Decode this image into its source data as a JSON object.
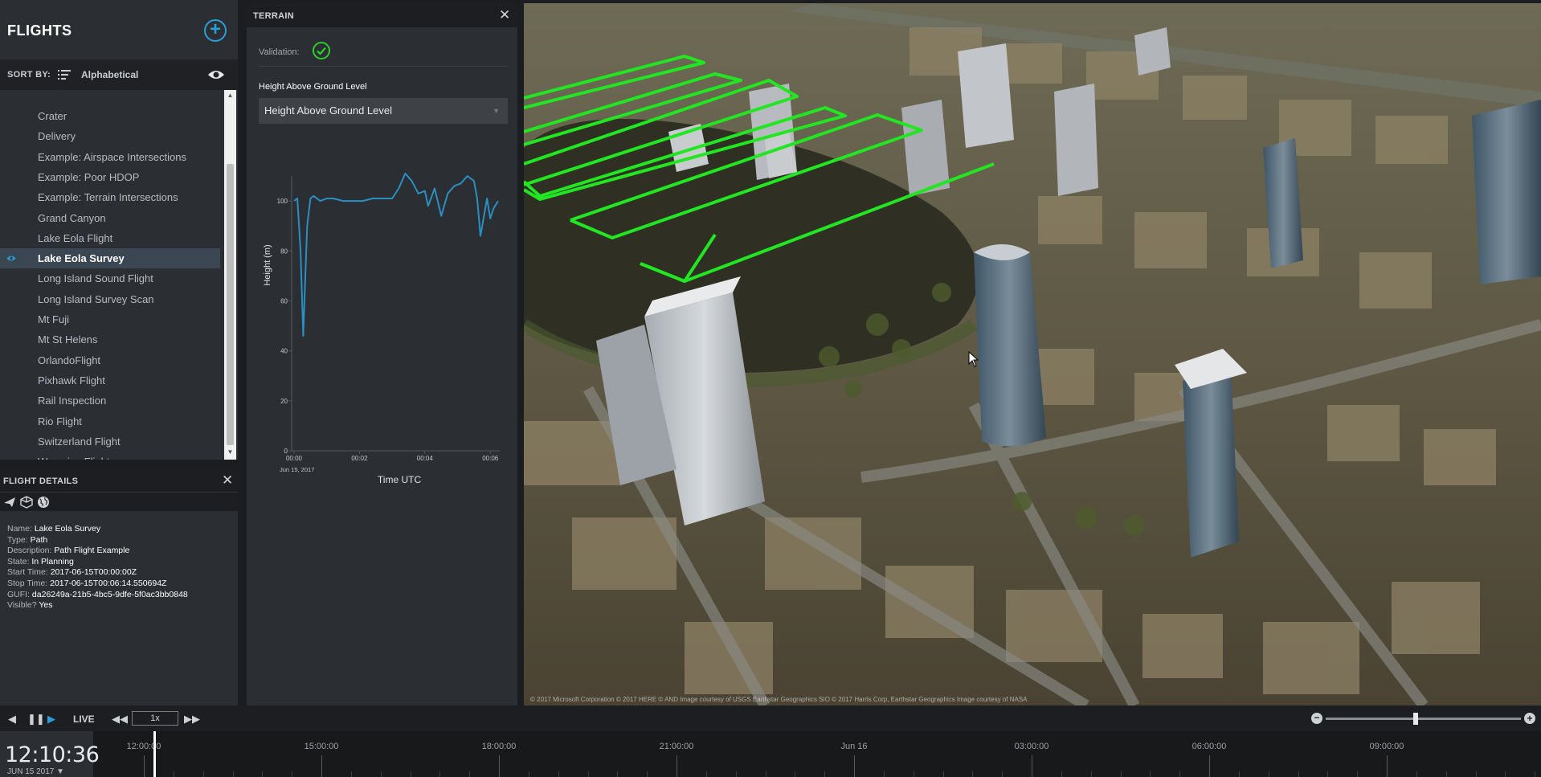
{
  "flights_panel": {
    "title": "FLIGHTS",
    "sort_by_label": "SORT BY:",
    "sort_value": "Alphabetical",
    "items": [
      {
        "label": "Crater",
        "selected": false
      },
      {
        "label": "Delivery",
        "selected": false
      },
      {
        "label": "Example: Airspace Intersections",
        "selected": false
      },
      {
        "label": "Example: Poor HDOP",
        "selected": false
      },
      {
        "label": "Example: Terrain Intersections",
        "selected": false
      },
      {
        "label": "Grand Canyon",
        "selected": false
      },
      {
        "label": "Lake Eola Flight",
        "selected": false
      },
      {
        "label": "Lake Eola Survey",
        "selected": true
      },
      {
        "label": "Long Island Sound Flight",
        "selected": false
      },
      {
        "label": "Long Island Survey Scan",
        "selected": false
      },
      {
        "label": "Mt Fuji",
        "selected": false
      },
      {
        "label": "Mt St Helens",
        "selected": false
      },
      {
        "label": "OrlandoFlight",
        "selected": false
      },
      {
        "label": "Pixhawk Flight",
        "selected": false
      },
      {
        "label": "Rail Inspection",
        "selected": false
      },
      {
        "label": "Rio Flight",
        "selected": false
      },
      {
        "label": "Switzerland Flight",
        "selected": false
      },
      {
        "label": "Wyoming Flight",
        "selected": false
      }
    ]
  },
  "flight_details": {
    "title": "FLIGHT DETAILS",
    "fields": [
      {
        "key": "Name:",
        "value": "Lake Eola Survey"
      },
      {
        "key": "Type:",
        "value": "Path"
      },
      {
        "key": "Description:",
        "value": "Path Flight Example"
      },
      {
        "key": "State:",
        "value": "In Planning"
      },
      {
        "key": "Start Time:",
        "value": "2017-06-15T00:00:00Z"
      },
      {
        "key": "Stop Time:",
        "value": "2017-06-15T00:06:14.550694Z"
      },
      {
        "key": "GUFI:",
        "value": "da26249a-21b5-4bc5-9dfe-5f0ac3bb0848"
      },
      {
        "key": "Visible?",
        "value": "Yes"
      }
    ]
  },
  "terrain_panel": {
    "title": "TERRAIN",
    "validation_label": "Validation:",
    "hagl_label": "Height Above Ground Level",
    "hagl_select_value": "Height Above Ground Level"
  },
  "chart_data": {
    "type": "line",
    "title": "",
    "xlabel": "Time UTC",
    "ylabel": "Height (m)",
    "x_ticks": [
      "00:00",
      "00:02",
      "00:04",
      "00:06"
    ],
    "x_date_label": "Jun 15, 2017",
    "y_ticks": [
      0,
      20,
      40,
      60,
      80,
      100
    ],
    "ylim": [
      0,
      110
    ],
    "xlim_minutes": [
      0,
      6.24
    ],
    "series": [
      {
        "color": "#2a8fc1",
        "x_minutes": [
          0,
          0.1,
          0.2,
          0.28,
          0.4,
          0.5,
          0.6,
          0.8,
          1.0,
          1.2,
          1.5,
          1.8,
          2.1,
          2.4,
          2.7,
          3.0,
          3.2,
          3.4,
          3.6,
          3.8,
          4.0,
          4.1,
          4.3,
          4.5,
          4.7,
          4.9,
          5.1,
          5.3,
          5.5,
          5.6,
          5.7,
          5.9,
          6.0,
          6.1,
          6.24
        ],
        "values": [
          100,
          101,
          80,
          46,
          90,
          101,
          102,
          100,
          101,
          101,
          100,
          100,
          100,
          101,
          101,
          101,
          105,
          111,
          108,
          103,
          104,
          98,
          105,
          94,
          103,
          106,
          107,
          110,
          108,
          101,
          86,
          101,
          93,
          97,
          100
        ]
      }
    ]
  },
  "map": {
    "attribution": "© 2017 Microsoft Corporation  © 2017 HERE  © AND  Image courtesy of USGS  Earthstar Geographics SIO  © 2017 Harris Corp, Earthstar Geographics  Image courtesy of NASA",
    "flight_path_color": "#22e622"
  },
  "timeline": {
    "live_label": "LIVE",
    "speed": "1x",
    "clock_time": "12:10:36",
    "clock_date": "JUN 15 2017",
    "ticks": [
      "12:00:00",
      "15:00:00",
      "18:00:00",
      "21:00:00",
      "Jun 16",
      "03:00:00",
      "06:00:00",
      "09:00:00"
    ]
  }
}
